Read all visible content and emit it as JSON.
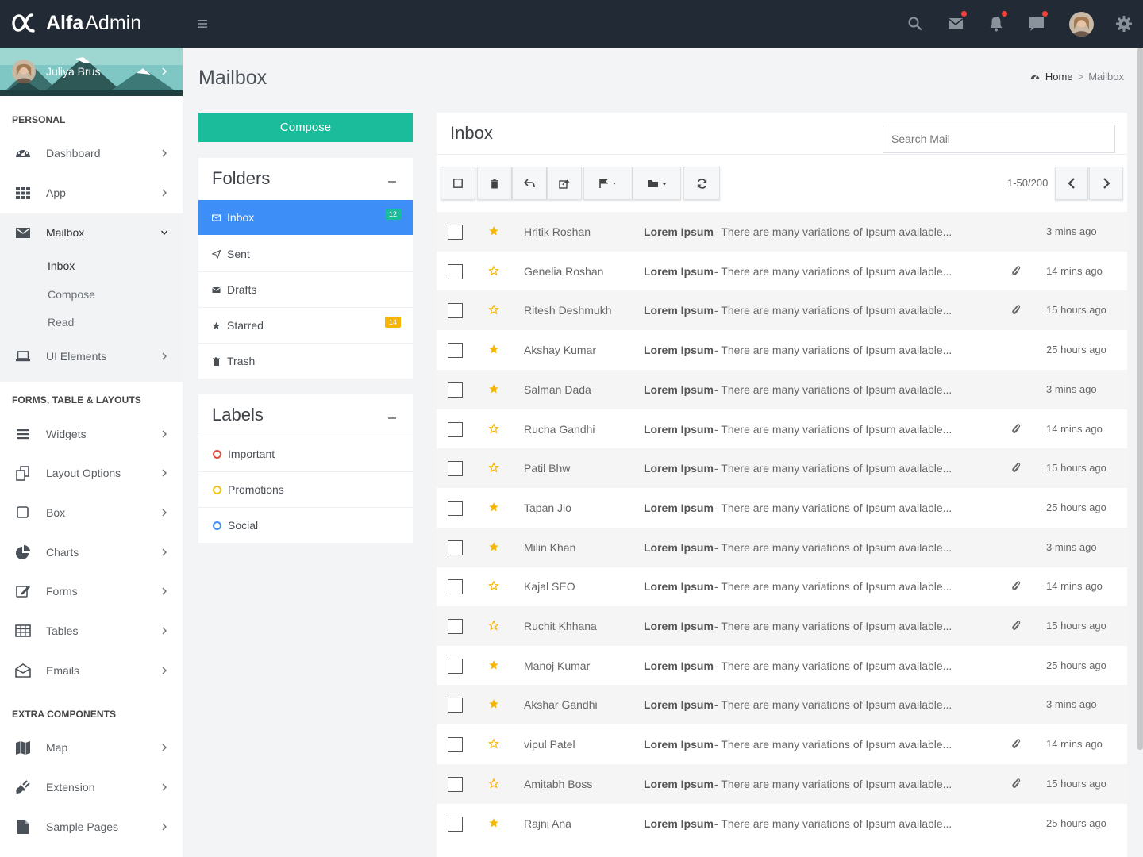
{
  "brand": {
    "bold": "Alfa",
    "light": "Admin"
  },
  "user": {
    "name": "Juliya Brus"
  },
  "sidebar": {
    "sections": [
      "PERSONAL",
      "FORMS, TABLE & LAYOUTS",
      "EXTRA COMPONENTS"
    ],
    "items": [
      {
        "label": "Dashboard",
        "icon": "dashboard-icon"
      },
      {
        "label": "App",
        "icon": "apps-grid-icon"
      },
      {
        "label": "Mailbox",
        "icon": "envelope-icon"
      },
      {
        "label": "UI Elements",
        "icon": "laptop-icon"
      },
      {
        "label": "Widgets",
        "icon": "bars-icon"
      },
      {
        "label": "Layout Options",
        "icon": "copy-icon"
      },
      {
        "label": "Box",
        "icon": "square-icon"
      },
      {
        "label": "Charts",
        "icon": "pie-chart-icon"
      },
      {
        "label": "Forms",
        "icon": "edit-icon"
      },
      {
        "label": "Tables",
        "icon": "table-icon"
      },
      {
        "label": "Emails",
        "icon": "envelope-open-icon"
      },
      {
        "label": "Map",
        "icon": "map-icon"
      },
      {
        "label": "Extension",
        "icon": "plug-icon"
      },
      {
        "label": "Sample Pages",
        "icon": "file-icon"
      }
    ],
    "mailbox_sub": [
      "Inbox",
      "Compose",
      "Read"
    ]
  },
  "page": {
    "title": "Mailbox"
  },
  "breadcrumb": {
    "home": "Home",
    "current": "Mailbox"
  },
  "compose": {
    "label": "Compose"
  },
  "folders": {
    "title": "Folders",
    "items": [
      {
        "label": "Inbox",
        "icon": "inbox-icon",
        "badge": "12",
        "active": true
      },
      {
        "label": "Sent",
        "icon": "paper-plane-icon",
        "badge": ""
      },
      {
        "label": "Drafts",
        "icon": "drafts-icon",
        "badge": ""
      },
      {
        "label": "Starred",
        "icon": "star-icon",
        "badge": "14"
      },
      {
        "label": "Trash",
        "icon": "trash-icon",
        "badge": ""
      }
    ]
  },
  "labels": {
    "title": "Labels",
    "items": [
      {
        "label": "Important",
        "color": "#e74c3c"
      },
      {
        "label": "Promotions",
        "color": "#f1c40f"
      },
      {
        "label": "Social",
        "color": "#3e8ef7"
      }
    ]
  },
  "inbox": {
    "title": "Inbox",
    "search_placeholder": "Search Mail",
    "pager": "1-50/200",
    "toolbar": [
      "select-all-checkbox-icon",
      "trash-icon",
      "reply-icon",
      "share-icon",
      "flag-icon",
      "folder-icon",
      "refresh-icon"
    ],
    "mails": [
      {
        "from": "Hritik Roshan",
        "subject": "Lorem Ipsum",
        "excerpt": "- There are many variations of Ipsum available...",
        "time": "3 mins ago",
        "starred": true,
        "attachment": false
      },
      {
        "from": "Genelia Roshan",
        "subject": "Lorem Ipsum",
        "excerpt": "- There are many variations of Ipsum available...",
        "time": "14 mins ago",
        "starred": false,
        "attachment": true
      },
      {
        "from": "Ritesh Deshmukh",
        "subject": "Lorem Ipsum",
        "excerpt": "- There are many variations of Ipsum available...",
        "time": "15 hours ago",
        "starred": false,
        "attachment": true
      },
      {
        "from": "Akshay Kumar",
        "subject": "Lorem Ipsum",
        "excerpt": "- There are many variations of Ipsum available...",
        "time": "25 hours ago",
        "starred": true,
        "attachment": false
      },
      {
        "from": "Salman Dada",
        "subject": "Lorem Ipsum",
        "excerpt": "- There are many variations of Ipsum available...",
        "time": "3 mins ago",
        "starred": true,
        "attachment": false
      },
      {
        "from": "Rucha Gandhi",
        "subject": "Lorem Ipsum",
        "excerpt": "- There are many variations of Ipsum available...",
        "time": "14 mins ago",
        "starred": false,
        "attachment": true
      },
      {
        "from": "Patil Bhw",
        "subject": "Lorem Ipsum",
        "excerpt": "- There are many variations of Ipsum available...",
        "time": "15 hours ago",
        "starred": false,
        "attachment": true
      },
      {
        "from": "Tapan Jio",
        "subject": "Lorem Ipsum",
        "excerpt": "- There are many variations of Ipsum available...",
        "time": "25 hours ago",
        "starred": true,
        "attachment": false
      },
      {
        "from": "Milin Khan",
        "subject": "Lorem Ipsum",
        "excerpt": "- There are many variations of Ipsum available...",
        "time": "3 mins ago",
        "starred": true,
        "attachment": false
      },
      {
        "from": "Kajal SEO",
        "subject": "Lorem Ipsum",
        "excerpt": "- There are many variations of Ipsum available...",
        "time": "14 mins ago",
        "starred": false,
        "attachment": true
      },
      {
        "from": "Ruchit Khhana",
        "subject": "Lorem Ipsum",
        "excerpt": "- There are many variations of Ipsum available...",
        "time": "15 hours ago",
        "starred": false,
        "attachment": true
      },
      {
        "from": "Manoj Kumar",
        "subject": "Lorem Ipsum",
        "excerpt": "- There are many variations of Ipsum available...",
        "time": "25 hours ago",
        "starred": true,
        "attachment": false
      },
      {
        "from": "Akshar Gandhi",
        "subject": "Lorem Ipsum",
        "excerpt": "- There are many variations of Ipsum available...",
        "time": "3 mins ago",
        "starred": true,
        "attachment": false
      },
      {
        "from": "vipul Patel",
        "subject": "Lorem Ipsum",
        "excerpt": "- There are many variations of Ipsum available...",
        "time": "14 mins ago",
        "starred": false,
        "attachment": true
      },
      {
        "from": "Amitabh Boss",
        "subject": "Lorem Ipsum",
        "excerpt": "- There are many variations of Ipsum available...",
        "time": "15 hours ago",
        "starred": false,
        "attachment": true
      },
      {
        "from": "Rajni Ana",
        "subject": "Lorem Ipsum",
        "excerpt": "- There are many variations of Ipsum available...",
        "time": "25 hours ago",
        "starred": true,
        "attachment": false
      }
    ]
  },
  "colors": {
    "header_bg": "#222b35",
    "accent_green": "#1bbc9b",
    "accent_blue": "#3e8ef7",
    "badge_green": "#1bbc9b",
    "badge_yellow": "#f7b500",
    "star": "#f7b500",
    "notification_dot": "#f44336"
  }
}
